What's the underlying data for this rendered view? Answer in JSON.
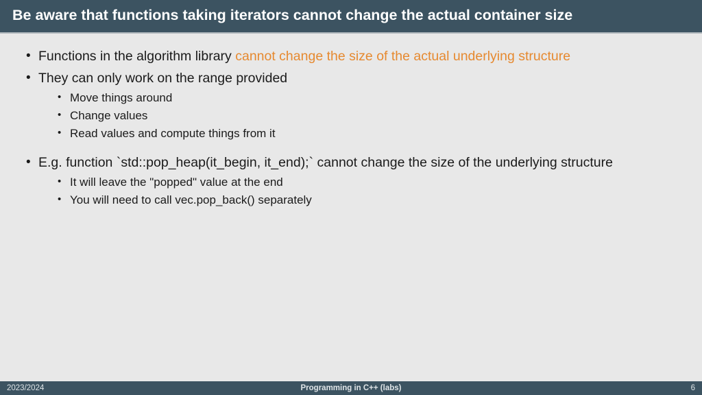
{
  "title": "Be aware that functions taking iterators cannot change the actual container size",
  "bullets": {
    "b1_pre": "Functions in the algorithm library ",
    "b1_accent": "cannot change the size of the actual underlying structure",
    "b2": "They can only work on the range provided",
    "b2_subs": {
      "s1": "Move things around",
      "s2": "Change values",
      "s3": "Read values and compute things from it"
    },
    "b3": "E.g. function `std::pop_heap(it_begin, it_end);` cannot change the size of the underlying structure",
    "b3_subs": {
      "s1": "It will leave the \"popped\" value at the end",
      "s2": "You will need to call vec.pop_back() separately"
    }
  },
  "footer": {
    "left": "2023/2024",
    "center": "Programming in C++ (labs)",
    "right": "6"
  },
  "colors": {
    "header_bg": "#3c5361",
    "slide_bg": "#e8e8e8",
    "accent": "#e6892f"
  }
}
